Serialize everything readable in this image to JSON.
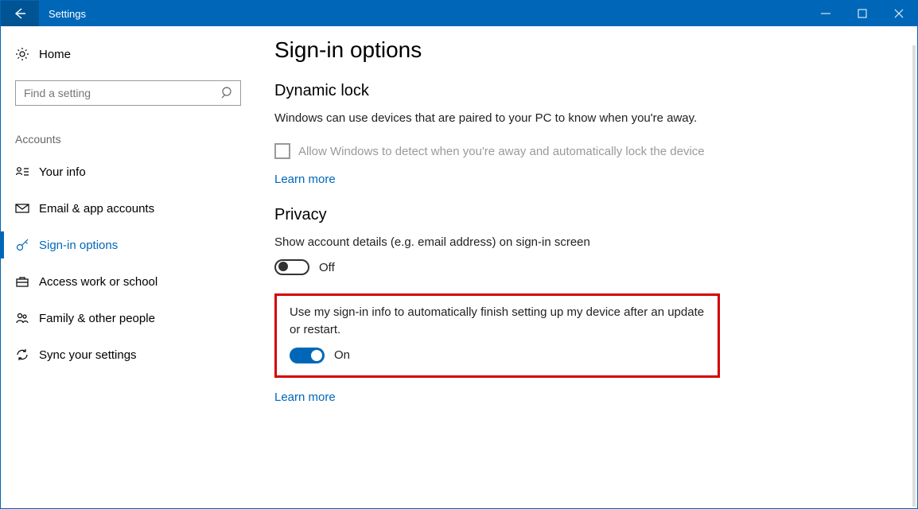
{
  "window": {
    "title": "Settings"
  },
  "sidebar": {
    "home_label": "Home",
    "search_placeholder": "Find a setting",
    "section_label": "Accounts",
    "items": [
      {
        "label": "Your info"
      },
      {
        "label": "Email & app accounts"
      },
      {
        "label": "Sign-in options"
      },
      {
        "label": "Access work or school"
      },
      {
        "label": "Family & other people"
      },
      {
        "label": "Sync your settings"
      }
    ]
  },
  "page": {
    "title": "Sign-in options",
    "dynamic_lock": {
      "heading": "Dynamic lock",
      "description": "Windows can use devices that are paired to your PC to know when you're away.",
      "checkbox_label": "Allow Windows to detect when you're away and automatically lock the device",
      "learn_more": "Learn more"
    },
    "privacy": {
      "heading": "Privacy",
      "toggle1_label": "Show account details (e.g. email address) on sign-in screen",
      "toggle1_value": "Off",
      "toggle2_label": "Use my sign-in info to automatically finish setting up my device after an update or restart.",
      "toggle2_value": "On",
      "learn_more": "Learn more"
    }
  }
}
